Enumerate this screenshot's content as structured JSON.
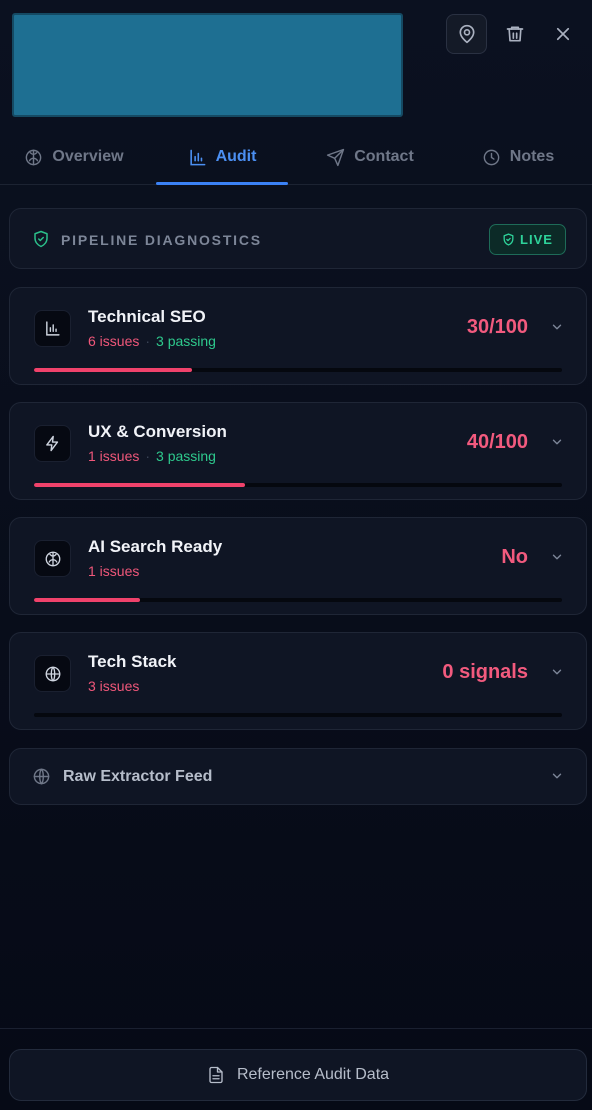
{
  "header": {
    "thumbnail_color": "#1e6f92",
    "icons": {
      "pin": "map-pin-icon",
      "trash": "trash-icon",
      "close": "close-icon"
    }
  },
  "tabs": [
    {
      "label": "Overview",
      "icon": "brain-icon",
      "active": false
    },
    {
      "label": "Audit",
      "icon": "bar-chart-icon",
      "active": true
    },
    {
      "label": "Contact",
      "icon": "send-icon",
      "active": false
    },
    {
      "label": "Notes",
      "icon": "clock-icon",
      "active": false
    }
  ],
  "diagnostics": {
    "title": "PIPELINE DIAGNOSTICS",
    "badge": "LIVE"
  },
  "sections": [
    {
      "title": "Technical SEO",
      "issues": "6 issues",
      "passing": "3 passing",
      "score": "30/100",
      "progress": 0.3,
      "icon": "bar-chart-icon"
    },
    {
      "title": "UX & Conversion",
      "issues": "1 issues",
      "passing": "3 passing",
      "score": "40/100",
      "progress": 0.4,
      "icon": "lightning-icon"
    },
    {
      "title": "AI Search Ready",
      "issues": "1 issues",
      "passing": "",
      "score": "No",
      "progress": 0.2,
      "icon": "brain-icon"
    },
    {
      "title": "Tech Stack",
      "issues": "3 issues",
      "passing": "",
      "score": "0 signals",
      "progress": 0.0,
      "icon": "globe-icon"
    }
  ],
  "raw_feed": {
    "title": "Raw Extractor Feed"
  },
  "footer": {
    "button_label": "Reference Audit Data"
  },
  "colors": {
    "accent": "#3b82f6",
    "danger": "#f0426b",
    "success": "#2ec98d"
  }
}
